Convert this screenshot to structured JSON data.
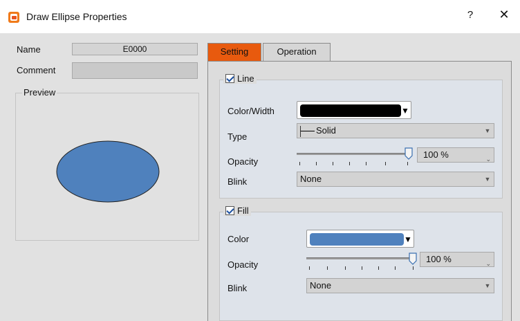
{
  "window": {
    "title": "Draw Ellipse Properties",
    "help_label": "?",
    "close_label": "✕"
  },
  "left": {
    "name_label": "Name",
    "name_value": "E0000",
    "comment_label": "Comment",
    "comment_value": "",
    "preview_label": "Preview"
  },
  "tabs": [
    {
      "label": "Setting",
      "active": true
    },
    {
      "label": "Operation",
      "active": false
    }
  ],
  "line": {
    "title": "Line",
    "checked": true,
    "color_width_label": "Color/Width",
    "color": "#000000",
    "type_label": "Type",
    "type_value": "Solid",
    "opacity_label": "Opacity",
    "opacity_value": "100 %",
    "opacity_level": 1.0,
    "blink_label": "Blink",
    "blink_value": "None"
  },
  "fill": {
    "title": "Fill",
    "checked": true,
    "color_label": "Color",
    "color": "#4f81bd",
    "opacity_label": "Opacity",
    "opacity_value": "100 %",
    "opacity_level": 1.0,
    "blink_label": "Blink",
    "blink_value": "None"
  },
  "colors": {
    "accent_tab": "#e85a0e",
    "ellipse_fill": "#4f81bd",
    "ellipse_stroke": "#222222"
  }
}
